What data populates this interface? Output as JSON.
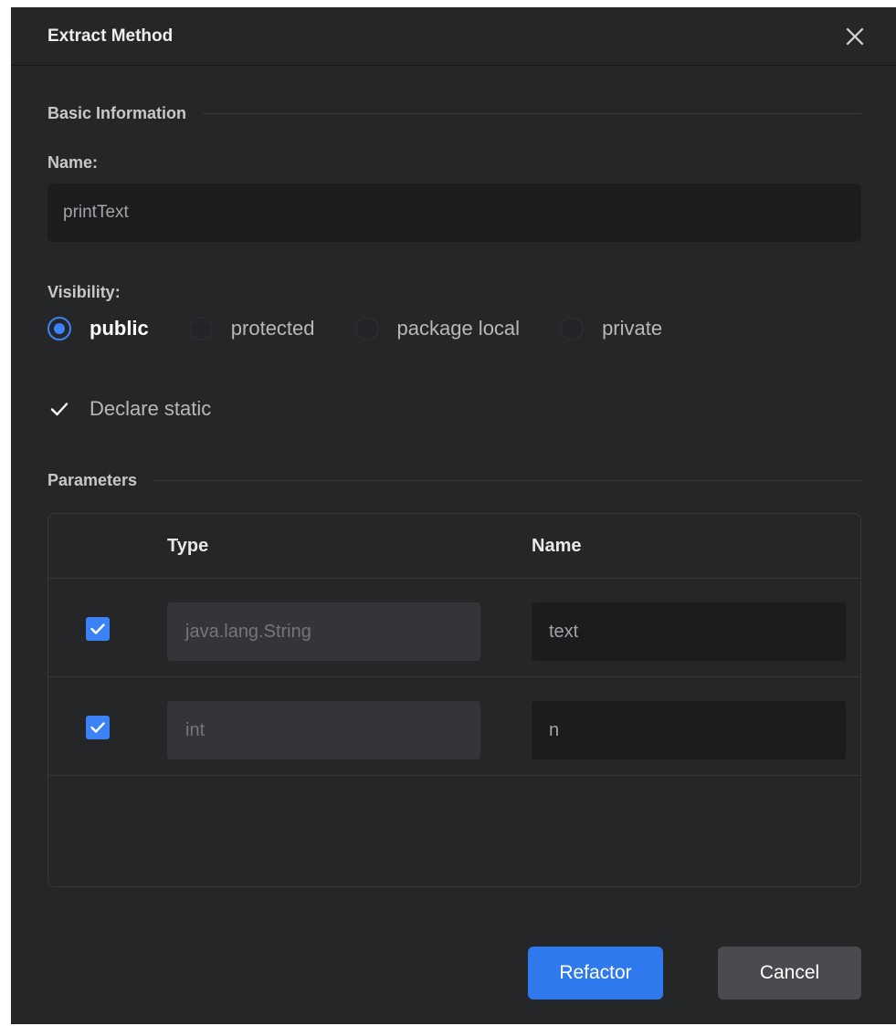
{
  "dialog": {
    "title": "Extract Method",
    "close_icon": "close-icon"
  },
  "basic_info": {
    "heading": "Basic Information",
    "name_label": "Name:",
    "name_value": "printText",
    "visibility_label": "Visibility:",
    "visibility_options": [
      {
        "label": "public",
        "selected": true
      },
      {
        "label": "protected",
        "selected": false
      },
      {
        "label": "package local",
        "selected": false
      },
      {
        "label": "private",
        "selected": false
      }
    ],
    "declare_static_label": "Declare static",
    "declare_static_checked": true
  },
  "parameters": {
    "heading": "Parameters",
    "columns": [
      "Type",
      "Name"
    ],
    "rows": [
      {
        "checked": true,
        "type": "java.lang.String",
        "name": "text"
      },
      {
        "checked": true,
        "type": "int",
        "name": "n"
      }
    ]
  },
  "footer": {
    "refactor_label": "Refactor",
    "cancel_label": "Cancel"
  },
  "colors": {
    "accent": "#3b82f6",
    "background": "#252628",
    "input_bg": "#1b1c1e"
  }
}
